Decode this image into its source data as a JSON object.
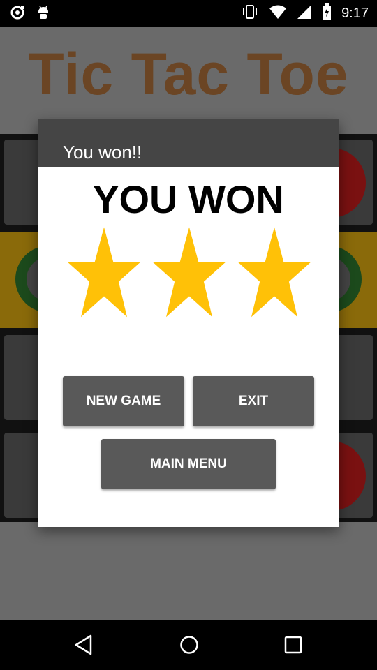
{
  "status_bar": {
    "time": "9:17",
    "left_icons": [
      "spinner-notification-icon",
      "android-debug-icon"
    ],
    "right_icons": [
      "vibrate-icon",
      "wifi-icon",
      "signal-icon",
      "battery-charging-icon"
    ]
  },
  "app": {
    "title": "Tic Tac Toe"
  },
  "dialog": {
    "title": "You won!!",
    "headline": "YOU WON",
    "stars_earned": 3,
    "stars_total": 3,
    "star_color": "#ffc107",
    "new_game_label": "NEW GAME",
    "exit_label": "EXIT",
    "main_menu_label": "MAIN MENU"
  },
  "nav_bar": {
    "icons": [
      "back-icon",
      "home-icon",
      "recents-icon"
    ]
  },
  "colors": {
    "title_brown": "#6b4524",
    "dialog_header": "#454545",
    "button": "#595959",
    "gold_row": "#8a6a0a"
  }
}
